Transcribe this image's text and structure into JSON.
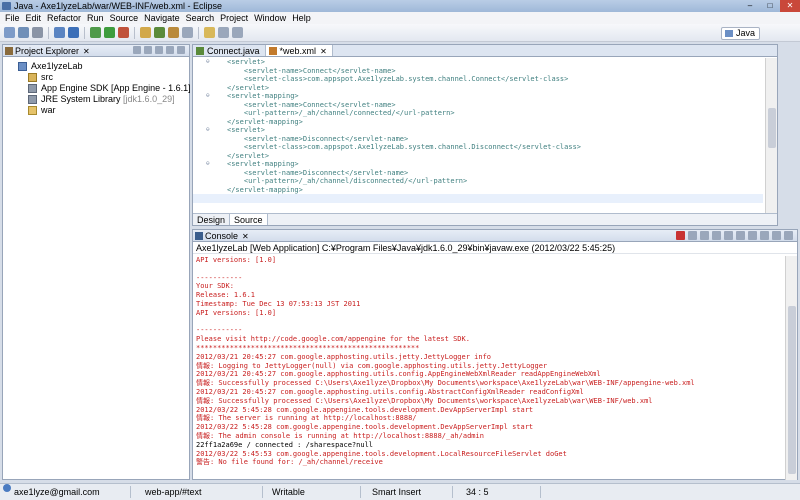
{
  "window": {
    "title": "Java - Axe1lyzeLab/war/WEB-INF/web.xml - Eclipse",
    "controls": [
      "–",
      "□",
      "✕"
    ]
  },
  "menu": [
    "File",
    "Edit",
    "Refactor",
    "Run",
    "Source",
    "Navigate",
    "Search",
    "Project",
    "Window",
    "Help"
  ],
  "toolbar": {
    "perspective_label": "Java"
  },
  "explorer": {
    "title": "Project Explorer",
    "tree": [
      {
        "label": "Axe1lyzeLab",
        "suffix": "",
        "icon": "project-icon"
      },
      {
        "label": "src",
        "suffix": "",
        "icon": "source-folder-icon"
      },
      {
        "label": "App Engine SDK [App Engine - 1.6.1]",
        "suffix": "",
        "icon": "library-icon"
      },
      {
        "label": "JRE System Library",
        "suffix": "[jdk1.6.0_29]",
        "icon": "library-icon"
      },
      {
        "label": "war",
        "suffix": "",
        "icon": "folder-icon"
      }
    ]
  },
  "editor": {
    "tabs": [
      {
        "label": "Connect.java",
        "icon": "java-file-icon"
      },
      {
        "label": "*web.xml",
        "icon": "xml-file-icon"
      }
    ],
    "lines": [
      "<servlet>",
      "    <servlet-name>Connect</servlet-name>",
      "    <servlet-class>com.appspot.Axe1lyzeLab.system.channel.Connect</servlet-class>",
      "</servlet>",
      "<servlet-mapping>",
      "    <servlet-name>Connect</servlet-name>",
      "    <url-pattern>/_ah/channel/connected/</url-pattern>",
      "</servlet-mapping>",
      "<servlet>",
      "    <servlet-name>Disconnect</servlet-name>",
      "    <servlet-class>com.appspot.Axe1lyzeLab.system.channel.Disconnect</servlet-class>",
      "</servlet>",
      "<servlet-mapping>",
      "    <servlet-name>Disconnect</servlet-name>",
      "    <url-pattern>/_ah/channel/disconnected/</url-pattern>",
      "</servlet-mapping>"
    ],
    "bottom_tabs": [
      "Design",
      "Source"
    ]
  },
  "console": {
    "title": "Console",
    "process": "Axe1lyzeLab [Web Application] C:¥Program Files¥Java¥jdk1.6.0_29¥bin¥javaw.exe (2012/03/22 5:45:25)",
    "lines": [
      {
        "text": "API versions: [1.0]",
        "out": false
      },
      {
        "text": "",
        "out": false
      },
      {
        "text": "-----------",
        "out": false
      },
      {
        "text": "Your SDK:",
        "out": false
      },
      {
        "text": "Release: 1.6.1",
        "out": false
      },
      {
        "text": "Timestamp: Tue Dec 13 07:53:13 JST 2011",
        "out": false
      },
      {
        "text": "API versions: [1.0]",
        "out": false
      },
      {
        "text": "",
        "out": false
      },
      {
        "text": "-----------",
        "out": false
      },
      {
        "text": "Please visit http://code.google.com/appengine for the latest SDK.",
        "out": false
      },
      {
        "text": "*****************************************************",
        "out": false
      },
      {
        "text": "2012/03/21 20:45:27 com.google.apphosting.utils.jetty.JettyLogger info",
        "out": false
      },
      {
        "text": "情報: Logging to JettyLogger(null) via com.google.apphosting.utils.jetty.JettyLogger",
        "out": false
      },
      {
        "text": "2012/03/21 20:45:27 com.google.apphosting.utils.config.AppEngineWebXmlReader readAppEngineWebXml",
        "out": false
      },
      {
        "text": "情報: Successfully processed C:\\Users\\Axe1lyze\\Dropbox\\My Documents\\workspace\\Axe1lyzeLab\\war\\WEB-INF/appengine-web.xml",
        "out": false
      },
      {
        "text": "2012/03/21 20:45:27 com.google.apphosting.utils.config.AbstractConfigXmlReader readConfigXml",
        "out": false
      },
      {
        "text": "情報: Successfully processed C:\\Users\\Axe1lyze\\Dropbox\\My Documents\\workspace\\Axe1lyzeLab\\war\\WEB-INF/web.xml",
        "out": false
      },
      {
        "text": "2012/03/22 5:45:28 com.google.appengine.tools.development.DevAppServerImpl start",
        "out": false
      },
      {
        "text": "情報: The server is running at http://localhost:8888/",
        "out": false
      },
      {
        "text": "2012/03/22 5:45:28 com.google.appengine.tools.development.DevAppServerImpl start",
        "out": false
      },
      {
        "text": "情報: The admin console is running at http://localhost:8888/_ah/admin",
        "out": false
      },
      {
        "text": "22ff1a2a69e / connected : /sharespace?null",
        "out": true
      },
      {
        "text": "2012/03/22 5:45:53 com.google.appengine.tools.development.LocalResourceFileServlet doGet",
        "out": false
      },
      {
        "text": "警告: No file found for: /_ah/channel/receive",
        "out": false
      }
    ]
  },
  "status": {
    "user": "axe1lyze@gmail.com",
    "path": "web-app/#text",
    "mode": "Writable",
    "insert": "Smart Insert",
    "position": "34 : 5"
  }
}
